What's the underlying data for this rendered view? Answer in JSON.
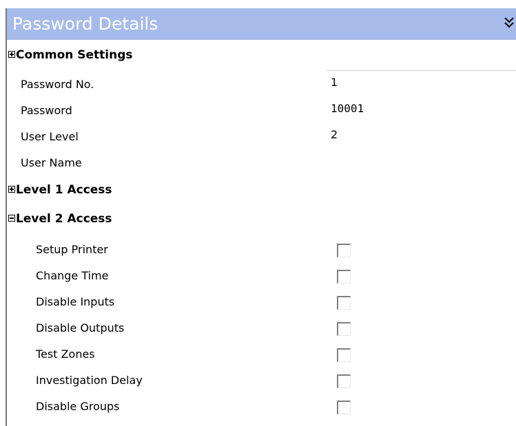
{
  "panel": {
    "title": "Password Details",
    "collapse_icon": "double-chevron-down-icon"
  },
  "sections": {
    "common_settings": {
      "label": "Common Settings",
      "expanded": false
    },
    "level1": {
      "label": "Level 1 Access",
      "expanded": false
    },
    "level2": {
      "label": "Level 2 Access",
      "expanded": true
    }
  },
  "common_settings": {
    "password_no": {
      "label": "Password No.",
      "value": "1"
    },
    "password": {
      "label": "Password",
      "value": "10001"
    },
    "user_level": {
      "label": "User Level",
      "value": "2"
    },
    "user_name": {
      "label": "User Name",
      "value": ""
    }
  },
  "level2_access": [
    {
      "label": "Setup Printer",
      "checked": false
    },
    {
      "label": "Change Time",
      "checked": false
    },
    {
      "label": "Disable Inputs",
      "checked": false
    },
    {
      "label": "Disable Outputs",
      "checked": false
    },
    {
      "label": "Test Zones",
      "checked": false
    },
    {
      "label": "Investigation Delay",
      "checked": false
    },
    {
      "label": "Disable Groups",
      "checked": false
    }
  ],
  "colors": {
    "header_bg": "#a7bbea",
    "header_text": "#ffffff"
  }
}
